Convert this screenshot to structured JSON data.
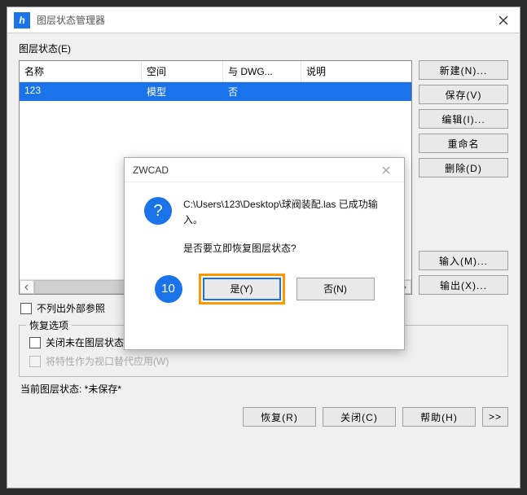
{
  "window": {
    "title": "图层状态管理器",
    "app_icon_glyph": "h"
  },
  "section_label": "图层状态(E)",
  "table": {
    "headers": [
      "名称",
      "空间",
      "与 DWG...",
      "说明"
    ],
    "rows": [
      {
        "name": "123",
        "space": "模型",
        "dwg": "否",
        "desc": ""
      }
    ]
  },
  "side_buttons": {
    "new": "新建(N)...",
    "save": "保存(V)",
    "edit": "编辑(I)...",
    "rename": "重命名",
    "delete": "删除(D)",
    "import": "输入(M)...",
    "export": "输出(X)..."
  },
  "checkbox_external": "不列出外部参照",
  "restore_group_label": "恢复选项",
  "checkbox_close_missing": "关闭未在图层状态中找到的图层(T)",
  "checkbox_viewport_override": "将特性作为视口替代应用(W)",
  "status_line": "当前图层状态:  *未保存*",
  "bottom_buttons": {
    "restore": "恢复(R)",
    "close": "关闭(C)",
    "help": "帮助(H)",
    "expand": ">>"
  },
  "modal": {
    "title": "ZWCAD",
    "line1": "C:\\Users\\123\\Desktop\\球阀装配.las 已成功输入。",
    "line2": "是否要立即恢复图层状态?",
    "yes": "是(Y)",
    "no": "否(N)",
    "badge": "10"
  }
}
